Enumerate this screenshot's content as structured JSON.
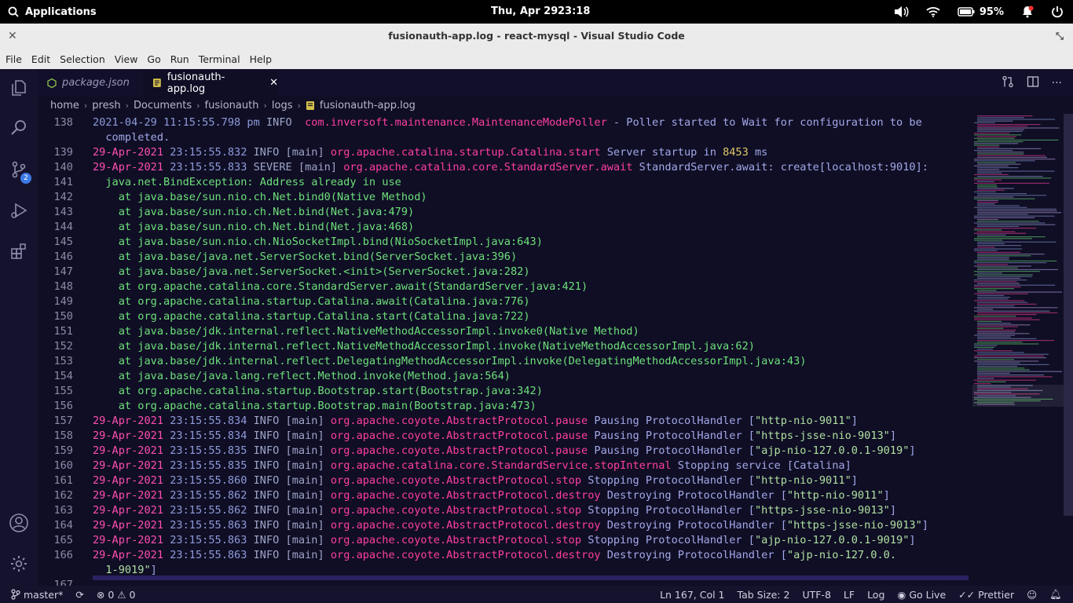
{
  "system": {
    "apps_label": "Applications",
    "date": "Thu, Apr 29",
    "time": "23:18",
    "battery": "95%"
  },
  "window": {
    "title": "fusionauth-app.log - react-mysql - Visual Studio Code"
  },
  "menu": [
    "File",
    "Edit",
    "Selection",
    "View",
    "Go",
    "Run",
    "Terminal",
    "Help"
  ],
  "activity": {
    "scm_badge": "2"
  },
  "tabs": [
    {
      "label": "package.json"
    },
    {
      "label": "fusionauth-app.log"
    }
  ],
  "breadcrumb": [
    "home",
    "presh",
    "Documents",
    "fusionauth",
    "logs",
    "fusionauth-app.log"
  ],
  "editor": {
    "lines": [
      {
        "n": "138",
        "parts": [
          [
            "c-time",
            "2021-04-29 11:15:55.798 pm "
          ],
          [
            "c-lvl",
            "INFO  "
          ],
          [
            "c-cls",
            "com.inversoft.maintenance.MaintenanceModePoller"
          ],
          [
            "c-msg",
            " - Poller started to Wait for configuration to be"
          ]
        ]
      },
      {
        "n": "",
        "parts": [
          [
            "c-msg",
            "  completed."
          ]
        ]
      },
      {
        "n": "139",
        "parts": [
          [
            "c-date",
            "29-Apr-2021"
          ],
          [
            "c-time",
            " 23:15:55.832 "
          ],
          [
            "c-lvl",
            "INFO "
          ],
          [
            "c-thr",
            "[main] "
          ],
          [
            "c-cls",
            "org.apache.catalina.startup.Catalina.start"
          ],
          [
            "c-msg",
            " Server startup in "
          ],
          [
            "c-num",
            "8453"
          ],
          [
            "c-msg",
            " ms"
          ]
        ]
      },
      {
        "n": "140",
        "parts": [
          [
            "c-date",
            "29-Apr-2021"
          ],
          [
            "c-time",
            " 23:15:55.833 "
          ],
          [
            "c-lvl",
            "SEVERE "
          ],
          [
            "c-thr",
            "[main] "
          ],
          [
            "c-cls",
            "org.apache.catalina.core.StandardServer.await"
          ],
          [
            "c-msg",
            " StandardServer.await: create[localhost:9010]:"
          ]
        ]
      },
      {
        "n": "141",
        "parts": [
          [
            "c-stack",
            "  java.net.BindException: Address already in use"
          ]
        ]
      },
      {
        "n": "142",
        "parts": [
          [
            "c-stack",
            "    at java.base/sun.nio.ch.Net.bind0(Native Method)"
          ]
        ]
      },
      {
        "n": "143",
        "parts": [
          [
            "c-stack",
            "    at java.base/sun.nio.ch.Net.bind(Net.java:479)"
          ]
        ]
      },
      {
        "n": "144",
        "parts": [
          [
            "c-stack",
            "    at java.base/sun.nio.ch.Net.bind(Net.java:468)"
          ]
        ]
      },
      {
        "n": "145",
        "parts": [
          [
            "c-stack",
            "    at java.base/sun.nio.ch.NioSocketImpl.bind(NioSocketImpl.java:643)"
          ]
        ]
      },
      {
        "n": "146",
        "parts": [
          [
            "c-stack",
            "    at java.base/java.net.ServerSocket.bind(ServerSocket.java:396)"
          ]
        ]
      },
      {
        "n": "147",
        "parts": [
          [
            "c-stack",
            "    at java.base/java.net.ServerSocket.<init>(ServerSocket.java:282)"
          ]
        ]
      },
      {
        "n": "148",
        "parts": [
          [
            "c-stack",
            "    at org.apache.catalina.core.StandardServer.await(StandardServer.java:421)"
          ]
        ]
      },
      {
        "n": "149",
        "parts": [
          [
            "c-stack",
            "    at org.apache.catalina.startup.Catalina.await(Catalina.java:776)"
          ]
        ]
      },
      {
        "n": "150",
        "parts": [
          [
            "c-stack",
            "    at org.apache.catalina.startup.Catalina.start(Catalina.java:722)"
          ]
        ]
      },
      {
        "n": "151",
        "parts": [
          [
            "c-stack",
            "    at java.base/jdk.internal.reflect.NativeMethodAccessorImpl.invoke0(Native Method)"
          ]
        ]
      },
      {
        "n": "152",
        "parts": [
          [
            "c-stack",
            "    at java.base/jdk.internal.reflect.NativeMethodAccessorImpl.invoke(NativeMethodAccessorImpl.java:62)"
          ]
        ]
      },
      {
        "n": "153",
        "parts": [
          [
            "c-stack",
            "    at java.base/jdk.internal.reflect.DelegatingMethodAccessorImpl.invoke(DelegatingMethodAccessorImpl.java:43)"
          ]
        ]
      },
      {
        "n": "154",
        "parts": [
          [
            "c-stack",
            "    at java.base/java.lang.reflect.Method.invoke(Method.java:564)"
          ]
        ]
      },
      {
        "n": "155",
        "parts": [
          [
            "c-stack",
            "    at org.apache.catalina.startup.Bootstrap.start(Bootstrap.java:342)"
          ]
        ]
      },
      {
        "n": "156",
        "parts": [
          [
            "c-stack",
            "    at org.apache.catalina.startup.Bootstrap.main(Bootstrap.java:473)"
          ]
        ]
      },
      {
        "n": "157",
        "parts": [
          [
            "c-date",
            "29-Apr-2021"
          ],
          [
            "c-time",
            " 23:15:55.834 "
          ],
          [
            "c-lvl",
            "INFO "
          ],
          [
            "c-thr",
            "[main] "
          ],
          [
            "c-cls",
            "org.apache.coyote.AbstractProtocol.pause"
          ],
          [
            "c-msg",
            " Pausing ProtocolHandler ["
          ],
          [
            "c-str",
            "\"http-nio-9011\""
          ],
          [
            "c-msg",
            "]"
          ]
        ]
      },
      {
        "n": "158",
        "parts": [
          [
            "c-date",
            "29-Apr-2021"
          ],
          [
            "c-time",
            " 23:15:55.834 "
          ],
          [
            "c-lvl",
            "INFO "
          ],
          [
            "c-thr",
            "[main] "
          ],
          [
            "c-cls",
            "org.apache.coyote.AbstractProtocol.pause"
          ],
          [
            "c-msg",
            " Pausing ProtocolHandler ["
          ],
          [
            "c-str",
            "\"https-jsse-nio-9013\""
          ],
          [
            "c-msg",
            "]"
          ]
        ]
      },
      {
        "n": "159",
        "parts": [
          [
            "c-date",
            "29-Apr-2021"
          ],
          [
            "c-time",
            " 23:15:55.835 "
          ],
          [
            "c-lvl",
            "INFO "
          ],
          [
            "c-thr",
            "[main] "
          ],
          [
            "c-cls",
            "org.apache.coyote.AbstractProtocol.pause"
          ],
          [
            "c-msg",
            " Pausing ProtocolHandler ["
          ],
          [
            "c-str",
            "\"ajp-nio-127.0.0.1-9019\""
          ],
          [
            "c-msg",
            "]"
          ]
        ]
      },
      {
        "n": "160",
        "parts": [
          [
            "c-date",
            "29-Apr-2021"
          ],
          [
            "c-time",
            " 23:15:55.835 "
          ],
          [
            "c-lvl",
            "INFO "
          ],
          [
            "c-thr",
            "[main] "
          ],
          [
            "c-cls",
            "org.apache.catalina.core.StandardService.stopInternal"
          ],
          [
            "c-msg",
            " Stopping service [Catalina]"
          ]
        ]
      },
      {
        "n": "161",
        "parts": [
          [
            "c-date",
            "29-Apr-2021"
          ],
          [
            "c-time",
            " 23:15:55.860 "
          ],
          [
            "c-lvl",
            "INFO "
          ],
          [
            "c-thr",
            "[main] "
          ],
          [
            "c-cls",
            "org.apache.coyote.AbstractProtocol.stop"
          ],
          [
            "c-msg",
            " Stopping ProtocolHandler ["
          ],
          [
            "c-str",
            "\"http-nio-9011\""
          ],
          [
            "c-msg",
            "]"
          ]
        ]
      },
      {
        "n": "162",
        "parts": [
          [
            "c-date",
            "29-Apr-2021"
          ],
          [
            "c-time",
            " 23:15:55.862 "
          ],
          [
            "c-lvl",
            "INFO "
          ],
          [
            "c-thr",
            "[main] "
          ],
          [
            "c-cls",
            "org.apache.coyote.AbstractProtocol.destroy"
          ],
          [
            "c-msg",
            " Destroying ProtocolHandler ["
          ],
          [
            "c-str",
            "\"http-nio-9011\""
          ],
          [
            "c-msg",
            "]"
          ]
        ]
      },
      {
        "n": "163",
        "parts": [
          [
            "c-date",
            "29-Apr-2021"
          ],
          [
            "c-time",
            " 23:15:55.862 "
          ],
          [
            "c-lvl",
            "INFO "
          ],
          [
            "c-thr",
            "[main] "
          ],
          [
            "c-cls",
            "org.apache.coyote.AbstractProtocol.stop"
          ],
          [
            "c-msg",
            " Stopping ProtocolHandler ["
          ],
          [
            "c-str",
            "\"https-jsse-nio-9013\""
          ],
          [
            "c-msg",
            "]"
          ]
        ]
      },
      {
        "n": "164",
        "parts": [
          [
            "c-date",
            "29-Apr-2021"
          ],
          [
            "c-time",
            " 23:15:55.863 "
          ],
          [
            "c-lvl",
            "INFO "
          ],
          [
            "c-thr",
            "[main] "
          ],
          [
            "c-cls",
            "org.apache.coyote.AbstractProtocol.destroy"
          ],
          [
            "c-msg",
            " Destroying ProtocolHandler ["
          ],
          [
            "c-str",
            "\"https-jsse-nio-9013\""
          ],
          [
            "c-msg",
            "]"
          ]
        ]
      },
      {
        "n": "165",
        "parts": [
          [
            "c-date",
            "29-Apr-2021"
          ],
          [
            "c-time",
            " 23:15:55.863 "
          ],
          [
            "c-lvl",
            "INFO "
          ],
          [
            "c-thr",
            "[main] "
          ],
          [
            "c-cls",
            "org.apache.coyote.AbstractProtocol.stop"
          ],
          [
            "c-msg",
            " Stopping ProtocolHandler ["
          ],
          [
            "c-str",
            "\"ajp-nio-127.0.0.1-9019\""
          ],
          [
            "c-msg",
            "]"
          ]
        ]
      },
      {
        "n": "166",
        "parts": [
          [
            "c-date",
            "29-Apr-2021"
          ],
          [
            "c-time",
            " 23:15:55.863 "
          ],
          [
            "c-lvl",
            "INFO "
          ],
          [
            "c-thr",
            "[main] "
          ],
          [
            "c-cls",
            "org.apache.coyote.AbstractProtocol.destroy"
          ],
          [
            "c-msg",
            " Destroying ProtocolHandler ["
          ],
          [
            "c-str",
            "\"ajp-nio-127.0.0."
          ]
        ]
      },
      {
        "n": "",
        "parts": [
          [
            "c-str",
            "  1-9019\""
          ],
          [
            "c-msg",
            "]"
          ]
        ]
      },
      {
        "n": "167",
        "parts": []
      }
    ]
  },
  "status": {
    "branch": "master*",
    "errors": "0",
    "warnings": "0",
    "position": "Ln 167, Col 1",
    "tab_size": "Tab Size: 2",
    "encoding": "UTF-8",
    "eol": "LF",
    "language": "Log",
    "go_live": "Go Live",
    "prettier": "Prettier"
  },
  "colors": {
    "editor_bg": "#0f0e25",
    "activity_bg": "#15122e",
    "accent": "#ff3fa0"
  }
}
